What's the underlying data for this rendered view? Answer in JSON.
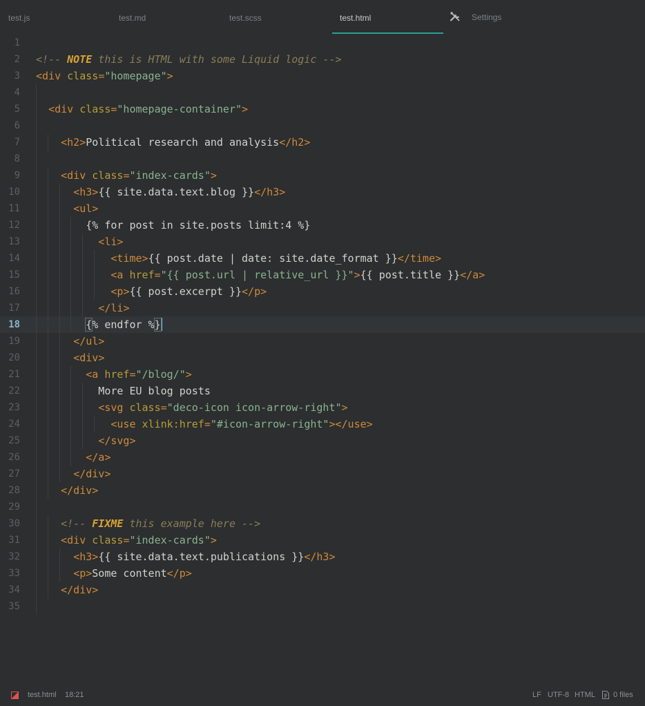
{
  "tabs": [
    {
      "label": "test.js",
      "active": false
    },
    {
      "label": "test.md",
      "active": false
    },
    {
      "label": "test.scss",
      "active": false
    },
    {
      "label": "test.html",
      "active": true
    },
    {
      "label": "Settings",
      "icon": "tools-icon",
      "active": false
    }
  ],
  "editor": {
    "current_line": 18,
    "lines": [
      "",
      "<!-- NOTE this is HTML with some Liquid logic -->",
      "<div class=\"homepage\">",
      "",
      "  <div class=\"homepage-container\">",
      "",
      "    <h2>Political research and analysis</h2>",
      "",
      "    <div class=\"index-cards\">",
      "      <h3>{{ site.data.text.blog }}</h3>",
      "      <ul>",
      "        {% for post in site.posts limit:4 %}",
      "          <li>",
      "            <time>{{ post.date | date: site.date_format }}</time>",
      "            <a href=\"{{ post.url | relative_url }}\">{{ post.title }}</a>",
      "            <p>{{ post.excerpt }}</p>",
      "          </li>",
      "        {% endfor %}",
      "      </ul>",
      "      <div>",
      "        <a href=\"/blog/\">",
      "          More EU blog posts",
      "          <svg class=\"deco-icon icon-arrow-right\">",
      "            <use xlink:href=\"#icon-arrow-right\"></use>",
      "          </svg>",
      "        </a>",
      "      </div>",
      "    </div>",
      "",
      "    <!-- FIXME this example here -->",
      "    <div class=\"index-cards\">",
      "      <h3>{{ site.data.text.publications }}</h3>",
      "      <p>Some content</p>",
      "    </div>",
      ""
    ]
  },
  "statusbar": {
    "file_icon": "error-flag-icon",
    "filename": "test.html",
    "position": "18:21",
    "line_ending": "LF",
    "encoding": "UTF-8",
    "language": "HTML",
    "files_icon": "files-icon",
    "files_count": "0 files"
  },
  "colors": {
    "background": "#2c2e2f",
    "tab_accent": "#2aa198",
    "tag": "#d08a3c",
    "attribute": "#b79d3a",
    "string": "#8bb390",
    "comment": "#8b7d58",
    "comment_keyword": "#d9a335",
    "text": "#d2d3cf",
    "error_icon": "#e05252"
  }
}
